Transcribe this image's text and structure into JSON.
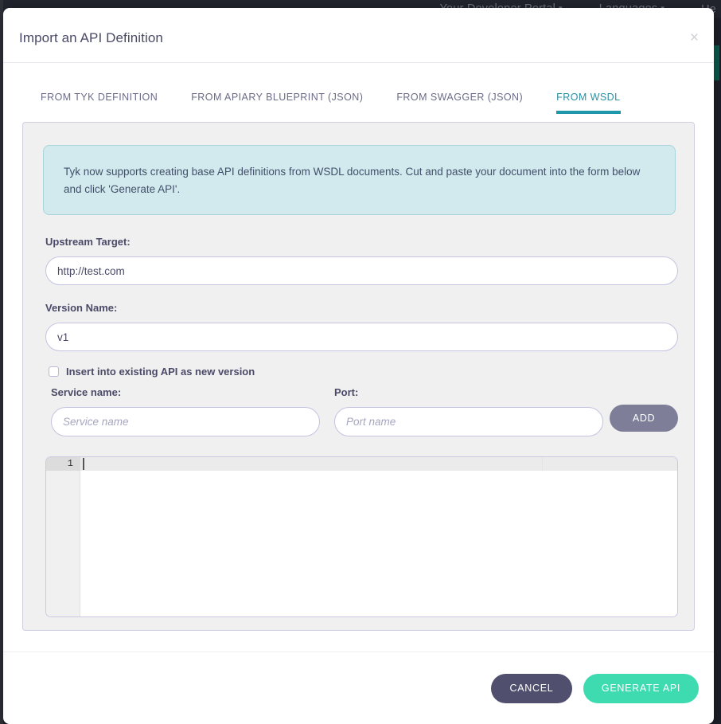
{
  "backdrop": {
    "nav_links": [
      {
        "label": "Your Developer Portal",
        "caret": "▾"
      },
      {
        "label": "Languages",
        "caret": "▾"
      },
      {
        "label": "He",
        "caret": ""
      }
    ]
  },
  "modal": {
    "title": "Import an API Definition",
    "close_icon": "×"
  },
  "tabs": [
    {
      "label": "FROM TYK DEFINITION",
      "active": false
    },
    {
      "label": "FROM APIARY BLUEPRINT (JSON)",
      "active": false
    },
    {
      "label": "FROM SWAGGER (JSON)",
      "active": false
    },
    {
      "label": "FROM WSDL",
      "active": true
    }
  ],
  "panel": {
    "info_text": "Tyk now supports creating base API definitions from WSDL documents. Cut and paste your document into the form below and click 'Generate API'.",
    "upstream": {
      "label": "Upstream Target:",
      "value": "http://test.com",
      "placeholder": ""
    },
    "version": {
      "label": "Version Name:",
      "value": "v1",
      "placeholder": ""
    },
    "insert_existing": {
      "label": "Insert into existing API as new version",
      "checked": false
    },
    "service": {
      "label": "Service name:",
      "value": "",
      "placeholder": "Service name"
    },
    "port": {
      "label": "Port:",
      "value": "",
      "placeholder": "Port name"
    },
    "add_button": "ADD",
    "editor": {
      "line_number": "1",
      "content": ""
    }
  },
  "footer": {
    "cancel_label": "CANCEL",
    "generate_label": "GENERATE API"
  },
  "colors": {
    "accent_teal": "#1f97ab",
    "primary_green": "#3edbb0",
    "dark_purple": "#504f6e",
    "info_bg": "#d2eaee",
    "muted_purple": "#7e7e99"
  }
}
